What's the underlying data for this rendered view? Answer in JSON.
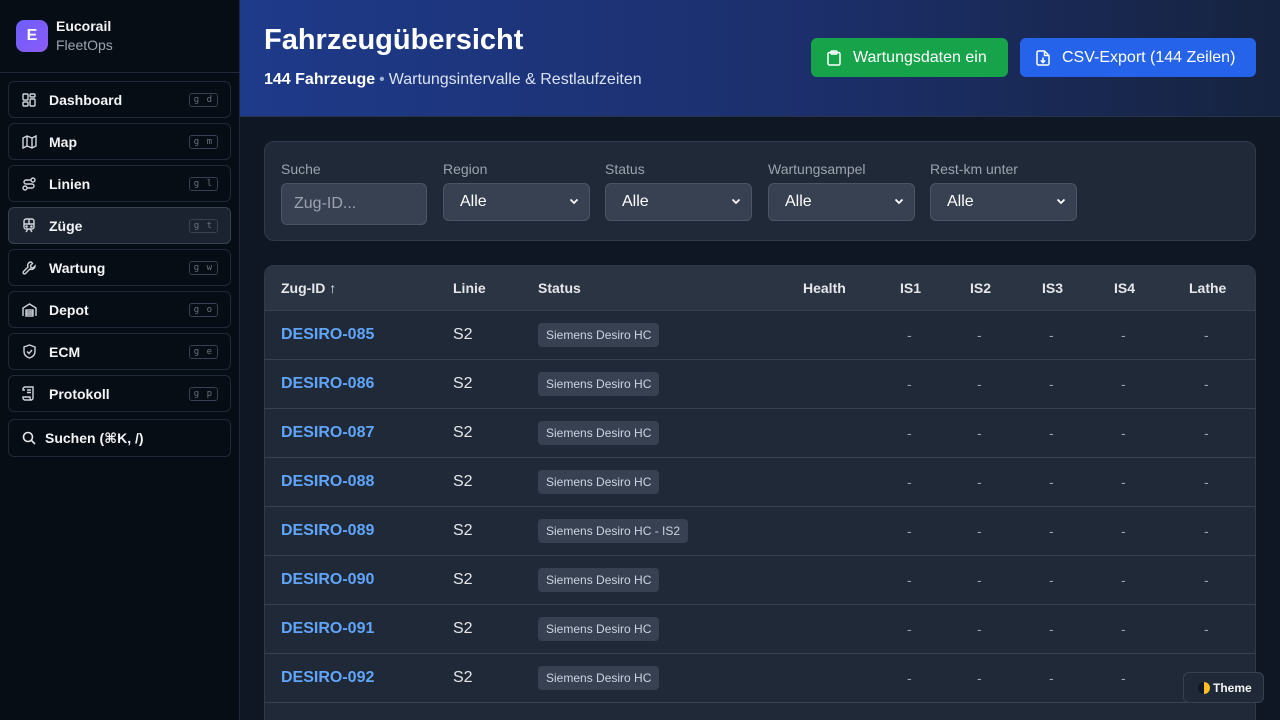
{
  "brand": {
    "logo_letter": "E",
    "name": "Eucorail",
    "sub": "FleetOps"
  },
  "nav": [
    {
      "label": "Dashboard",
      "key": "g d",
      "icon": "dashboard-icon"
    },
    {
      "label": "Map",
      "key": "g m",
      "icon": "map-icon"
    },
    {
      "label": "Linien",
      "key": "g l",
      "icon": "route-icon"
    },
    {
      "label": "Züge",
      "key": "g t",
      "icon": "train-icon",
      "active": true
    },
    {
      "label": "Wartung",
      "key": "g w",
      "icon": "wrench-icon"
    },
    {
      "label": "Depot",
      "key": "g o",
      "icon": "warehouse-icon"
    },
    {
      "label": "ECM",
      "key": "g e",
      "icon": "shield-icon"
    },
    {
      "label": "Protokoll",
      "key": "g p",
      "icon": "scroll-icon"
    }
  ],
  "search_nav": {
    "label": "Suchen (⌘K, /)"
  },
  "header": {
    "title": "Fahrzeugübersicht",
    "count": "144 Fahrzeuge",
    "separator": "•",
    "subtitle": "Wartungsintervalle & Restlaufzeiten",
    "btn_maint": "Wartungsdaten ein",
    "btn_csv": "CSV-Export (144 Zeilen)"
  },
  "filters": {
    "search_label": "Suche",
    "search_placeholder": "Zug-ID...",
    "region_label": "Region",
    "region_value": "Alle",
    "status_label": "Status",
    "status_value": "Alle",
    "ampel_label": "Wartungsampel",
    "ampel_value": "Alle",
    "restkm_label": "Rest-km unter",
    "restkm_value": "Alle"
  },
  "table": {
    "headers": {
      "id": "Zug-ID ↑",
      "linie": "Linie",
      "status": "Status",
      "health": "Health",
      "is1": "IS1",
      "is2": "IS2",
      "is3": "IS3",
      "is4": "IS4",
      "lathe": "Lathe"
    },
    "rows": [
      {
        "id": "DESIRO-085",
        "linie": "S2",
        "status": "Siemens Desiro HC",
        "is1": "-",
        "is2": "-",
        "is3": "-",
        "is4": "-",
        "lathe": "-"
      },
      {
        "id": "DESIRO-086",
        "linie": "S2",
        "status": "Siemens Desiro HC",
        "is1": "-",
        "is2": "-",
        "is3": "-",
        "is4": "-",
        "lathe": "-"
      },
      {
        "id": "DESIRO-087",
        "linie": "S2",
        "status": "Siemens Desiro HC",
        "is1": "-",
        "is2": "-",
        "is3": "-",
        "is4": "-",
        "lathe": "-"
      },
      {
        "id": "DESIRO-088",
        "linie": "S2",
        "status": "Siemens Desiro HC",
        "is1": "-",
        "is2": "-",
        "is3": "-",
        "is4": "-",
        "lathe": "-"
      },
      {
        "id": "DESIRO-089",
        "linie": "S2",
        "status": "Siemens Desiro HC - IS2",
        "is1": "-",
        "is2": "-",
        "is3": "-",
        "is4": "-",
        "lathe": "-"
      },
      {
        "id": "DESIRO-090",
        "linie": "S2",
        "status": "Siemens Desiro HC",
        "is1": "-",
        "is2": "-",
        "is3": "-",
        "is4": "-",
        "lathe": "-"
      },
      {
        "id": "DESIRO-091",
        "linie": "S2",
        "status": "Siemens Desiro HC",
        "is1": "-",
        "is2": "-",
        "is3": "-",
        "is4": "-",
        "lathe": "-"
      },
      {
        "id": "DESIRO-092",
        "linie": "S2",
        "status": "Siemens Desiro HC",
        "is1": "-",
        "is2": "-",
        "is3": "-",
        "is4": "-",
        "lathe": "-"
      }
    ]
  },
  "theme_button": "Theme"
}
